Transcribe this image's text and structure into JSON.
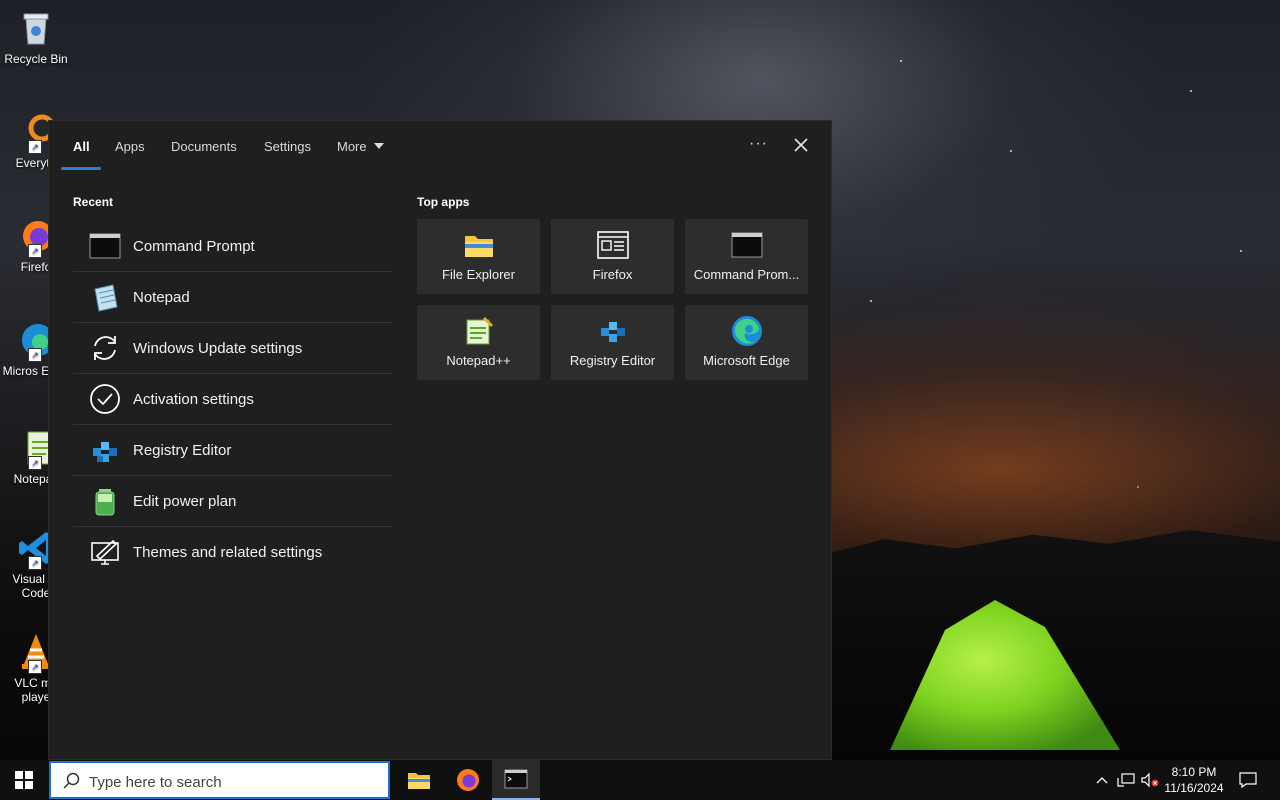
{
  "desktop": {
    "icons": [
      {
        "label": "Recycle Bin"
      },
      {
        "label": "Everyth"
      },
      {
        "label": "Firefo"
      },
      {
        "label": "Micros Edge"
      },
      {
        "label": "Notepac"
      },
      {
        "label": "Visual St Code"
      },
      {
        "label": "VLC me playe"
      }
    ]
  },
  "search_panel": {
    "tabs": [
      {
        "label": "All"
      },
      {
        "label": "Apps"
      },
      {
        "label": "Documents"
      },
      {
        "label": "Settings"
      },
      {
        "label": "More"
      }
    ],
    "active_tab": "All",
    "recent_title": "Recent",
    "recent": [
      {
        "label": "Command Prompt",
        "icon": "command-prompt-icon"
      },
      {
        "label": "Notepad",
        "icon": "notepad-icon"
      },
      {
        "label": "Windows Update settings",
        "icon": "refresh-icon"
      },
      {
        "label": "Activation settings",
        "icon": "checkmark-circle-icon"
      },
      {
        "label": "Registry Editor",
        "icon": "registry-editor-icon"
      },
      {
        "label": "Edit power plan",
        "icon": "battery-icon"
      },
      {
        "label": "Themes and related settings",
        "icon": "pen-monitor-icon"
      }
    ],
    "top_apps_title": "Top apps",
    "top_apps": [
      {
        "label": "File Explorer",
        "icon": "folder-icon"
      },
      {
        "label": "Firefox",
        "icon": "generic-app-icon"
      },
      {
        "label": "Command Prom...",
        "icon": "command-prompt-icon"
      },
      {
        "label": "Notepad++",
        "icon": "notepadpp-icon"
      },
      {
        "label": "Registry Editor",
        "icon": "registry-editor-icon"
      },
      {
        "label": "Microsoft Edge",
        "icon": "edge-icon"
      }
    ],
    "accent_color": "#2f7fd8"
  },
  "taskbar": {
    "search_placeholder": "Type here to search",
    "pinned": [
      "File Explorer",
      "Firefox",
      "Command Prompt"
    ],
    "clock_time": "8:10 PM",
    "clock_date": "11/16/2024"
  }
}
